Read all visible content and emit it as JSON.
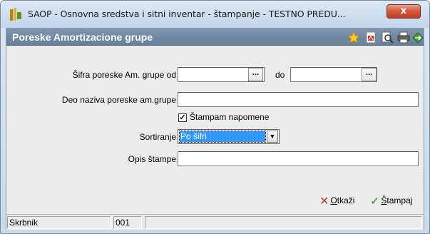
{
  "window": {
    "title": "SAOP - Osnovna sredstva i sitni inventar - štampanje - TESTNO PREDU...",
    "close_label": "x"
  },
  "header": {
    "title": "Poreske Amortizacione grupe",
    "icons": [
      "star-icon",
      "pdf-icon",
      "print-preview-icon",
      "printer-icon",
      "exit-icon"
    ]
  },
  "form": {
    "sifra_od_label": "Šifra poreske Am. grupe od",
    "sifra_od_value": "",
    "dots_label": "...",
    "do_label": "do",
    "sifra_do_value": "",
    "deo_naziva_label": "Deo naziva poreske am.grupe",
    "deo_naziva_value": "",
    "stampam_napomene_label": "Štampam napomene",
    "stampam_napomene_checked": true,
    "check_mark": "✓",
    "sortiranje_label": "Sortiranje",
    "sortiranje_value": "Po šifri",
    "opis_stampe_label": "Opis štampe",
    "opis_stampe_value": ""
  },
  "actions": {
    "cancel_prefix": "",
    "cancel_underlined": "O",
    "cancel_rest": "tkaži",
    "print_prefix": "",
    "print_underlined": "Š",
    "print_rest": "tampaj"
  },
  "status": {
    "user": "Skrbnik",
    "code": "001",
    "extra": ""
  },
  "colors": {
    "header_bg": "#6f88a3",
    "selection": "#3399ff",
    "close": "#c8452b"
  }
}
